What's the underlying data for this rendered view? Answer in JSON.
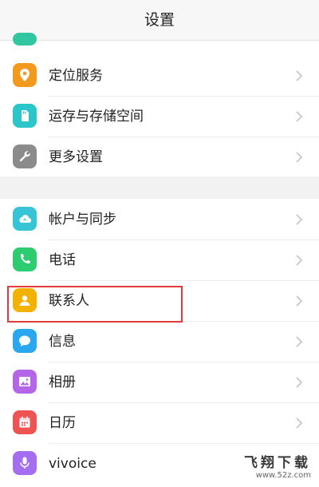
{
  "header": {
    "title": "设置"
  },
  "group1": [
    {
      "label": "定位服务",
      "icon": "location-pin-icon",
      "color": "#f39a1e"
    },
    {
      "label": "运存与存储空间",
      "icon": "memory-card-icon",
      "color": "#2bc6c9"
    },
    {
      "label": "更多设置",
      "icon": "wrench-icon",
      "color": "#8b8b8b"
    }
  ],
  "group2": [
    {
      "label": "帐户与同步",
      "icon": "cloud-sync-icon",
      "color": "#36c5d6"
    },
    {
      "label": "电话",
      "icon": "phone-icon",
      "color": "#2ecc71"
    },
    {
      "label": "联系人",
      "icon": "contact-person-icon",
      "color": "#f5b100"
    },
    {
      "label": "信息",
      "icon": "message-bubble-icon",
      "color": "#29a8f0"
    },
    {
      "label": "相册",
      "icon": "gallery-icon",
      "color": "#b465e8"
    },
    {
      "label": "日历",
      "icon": "calendar-icon",
      "color": "#ef5454"
    },
    {
      "label": "vivoice",
      "icon": "microphone-icon",
      "color": "#a56ef0"
    }
  ],
  "watermark": {
    "title": "飞翔下载",
    "url": "www.52z.com"
  },
  "colors": {
    "highlight": "#e23b3b",
    "chevron": "#c7c7c7"
  }
}
